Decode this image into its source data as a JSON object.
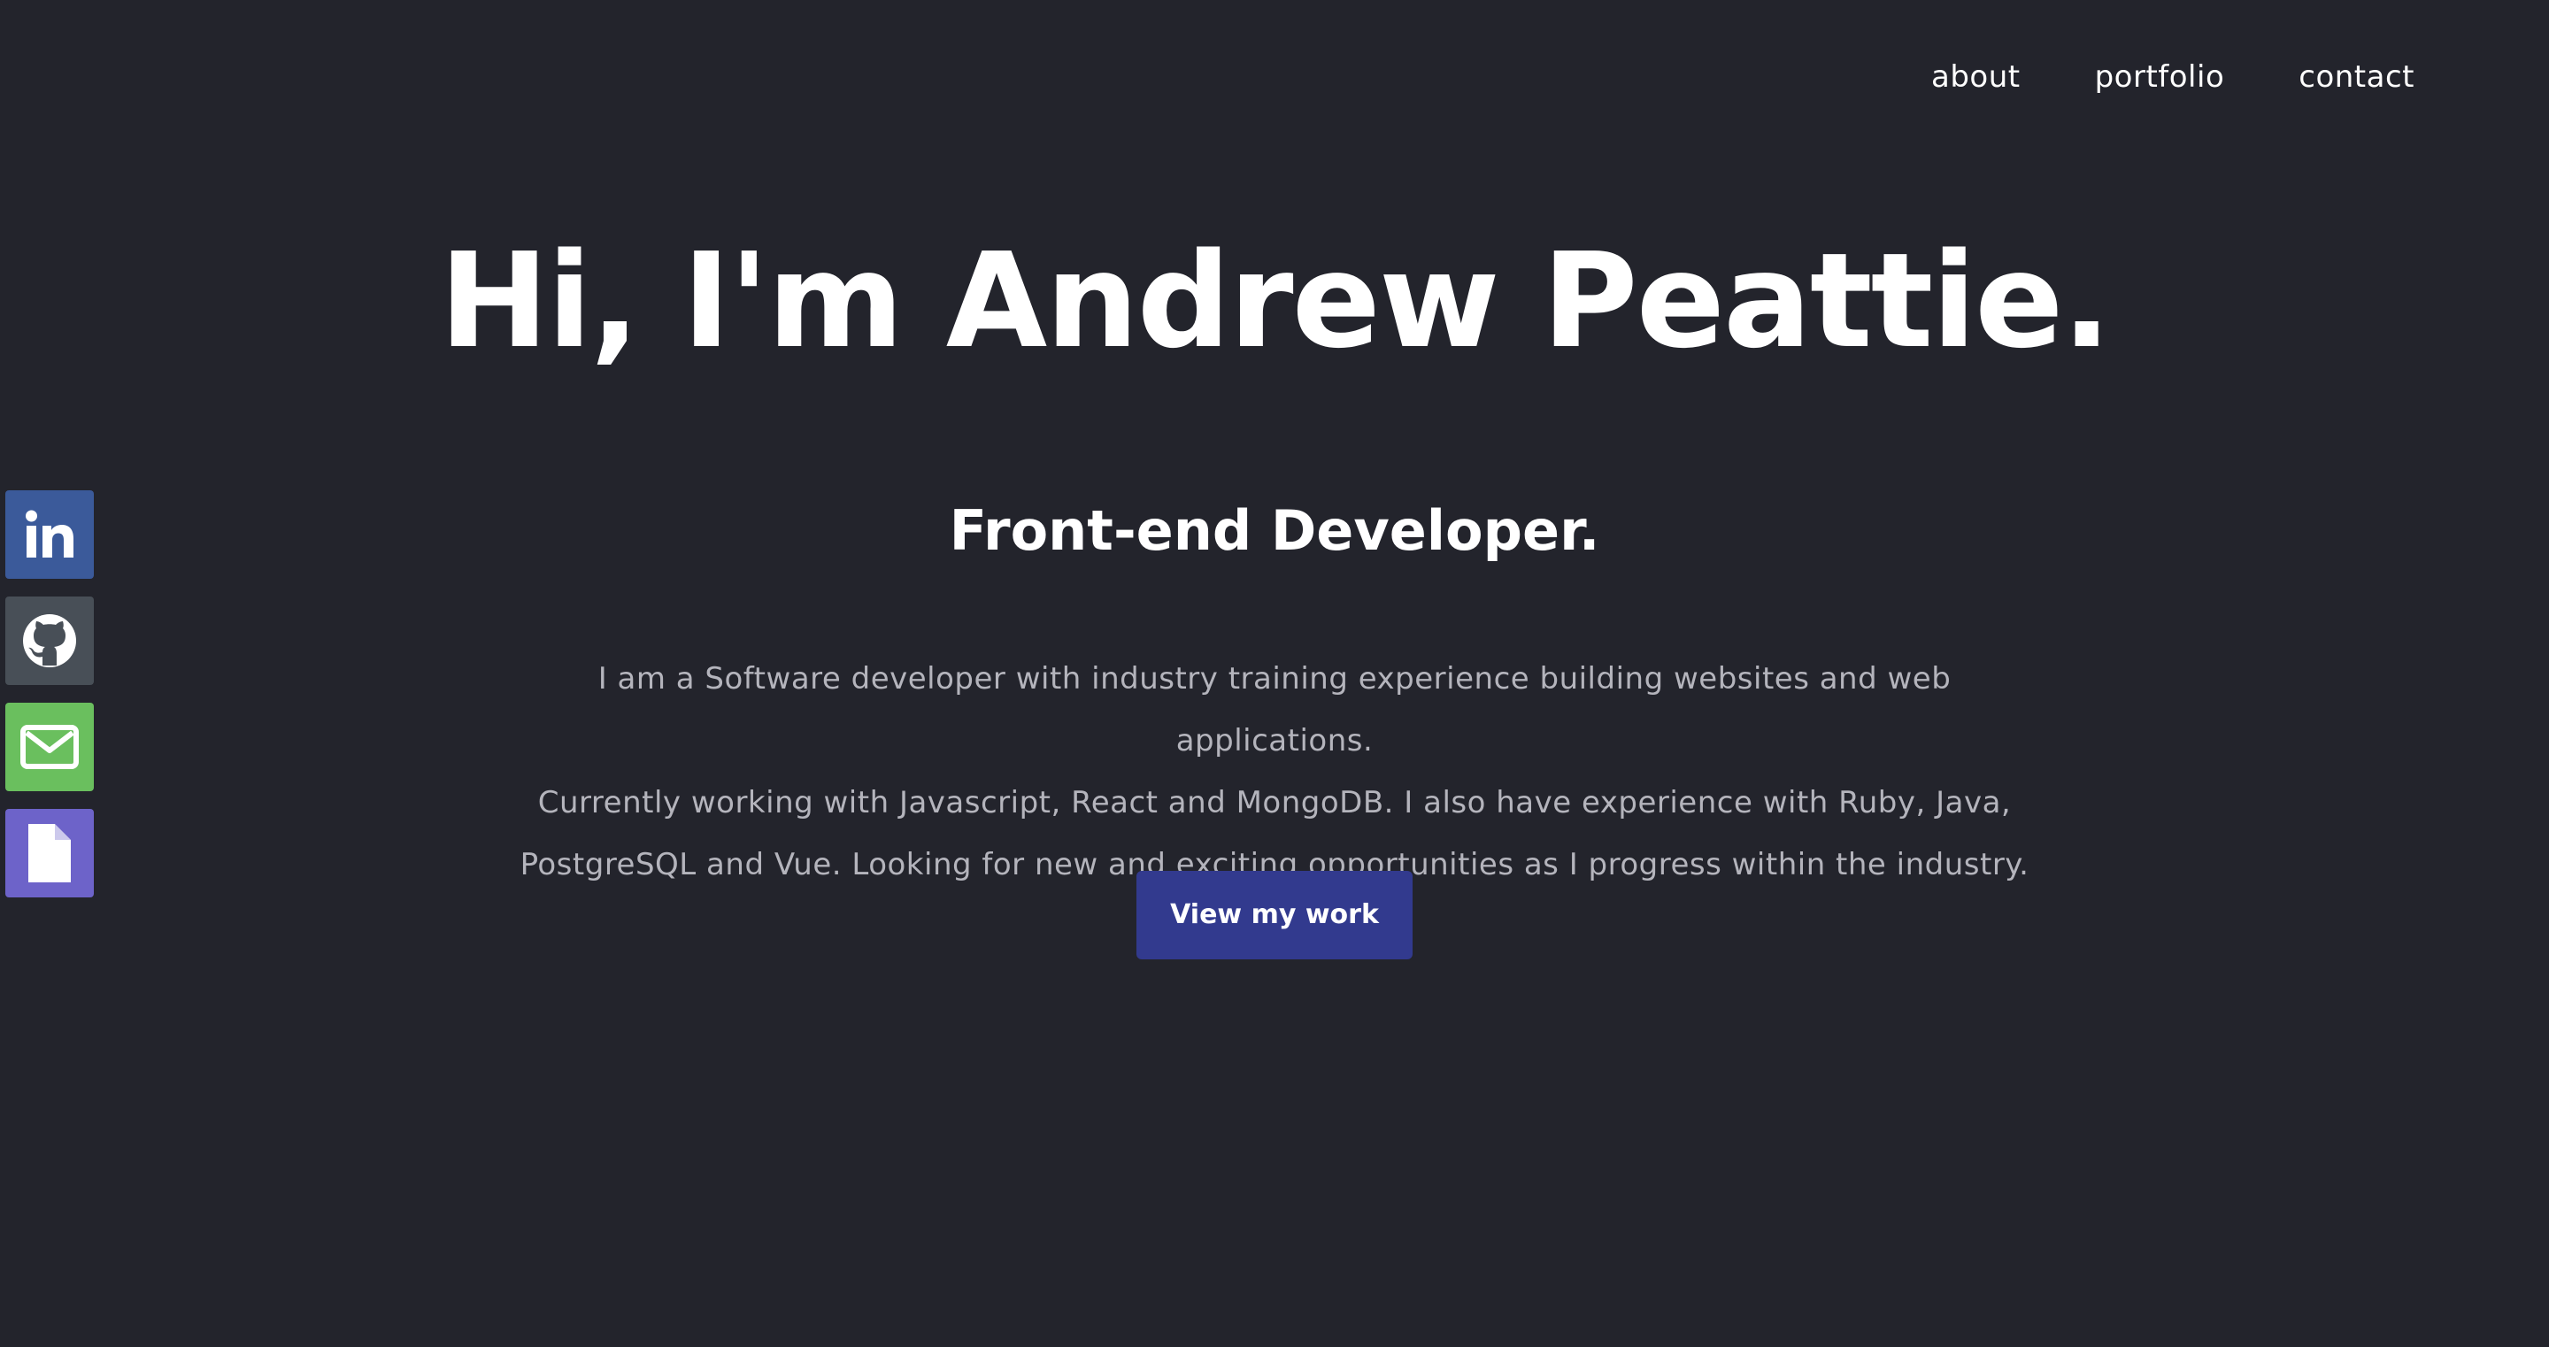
{
  "nav": {
    "items": [
      {
        "label": "about"
      },
      {
        "label": "portfolio"
      },
      {
        "label": "contact"
      }
    ]
  },
  "hero": {
    "title": "Hi, I'm Andrew Peattie.",
    "subtitle": "Front-end Developer.",
    "description_lines": [
      "I am a Software developer with industry training experience building websites and web applications.",
      "Currently working with Javascript, React and MongoDB. I also have experience with Ruby, Java,",
      "PostgreSQL and Vue. Looking for new and exciting opportunities as I progress within the industry."
    ],
    "cta_label": "View my work"
  },
  "social": {
    "items": [
      {
        "icon": "linkedin-icon",
        "color": "#3b5a9a"
      },
      {
        "icon": "github-icon",
        "color": "#484f57"
      },
      {
        "icon": "email-icon",
        "color": "#6abf5e"
      },
      {
        "icon": "document-icon",
        "color": "#6d63c9"
      }
    ]
  },
  "colors": {
    "background": "#23242c",
    "accent": "#323a8e",
    "text": "#ffffff",
    "muted_text": "#b4b4bc"
  }
}
